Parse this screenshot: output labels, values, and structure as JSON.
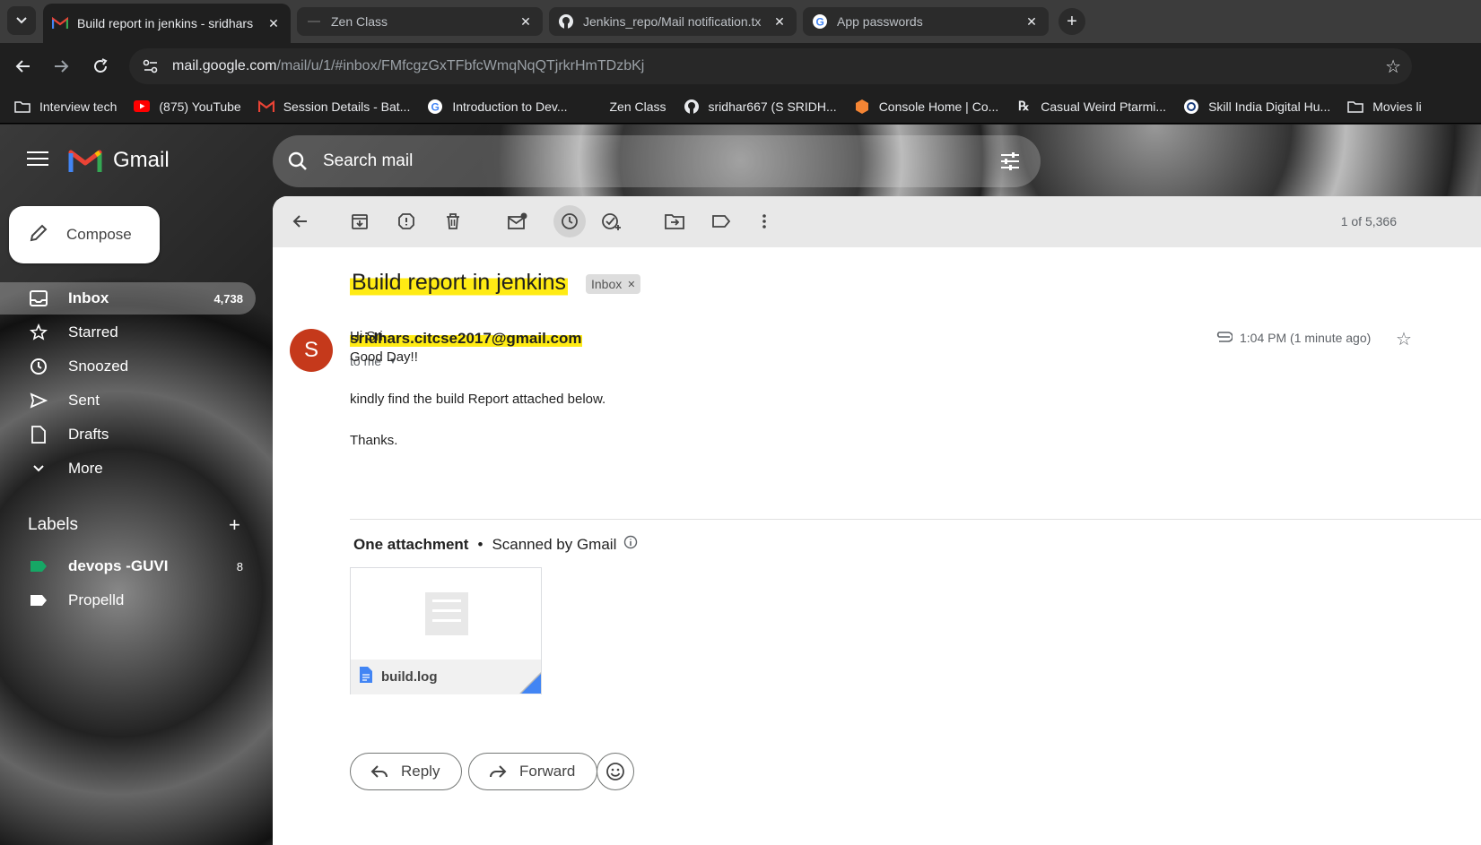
{
  "browser": {
    "tabs": [
      {
        "label": "Build report in jenkins - sridhars",
        "icon": "gmail-icon",
        "active": true
      },
      {
        "label": "Zen Class",
        "icon": "zen-icon",
        "active": false
      },
      {
        "label": "Jenkins_repo/Mail notification.tx",
        "icon": "github-icon",
        "active": false
      },
      {
        "label": "App passwords",
        "icon": "google-icon",
        "active": false
      }
    ],
    "url_host": "mail.google.com",
    "url_path": "/mail/u/1/#inbox/FMfcgzGxTFbfcWmqNqQTjrkrHmTDzbKj",
    "bookmarks": [
      {
        "label": "Interview tech",
        "icon": "folder-icon"
      },
      {
        "label": "(875) YouTube",
        "icon": "youtube-icon"
      },
      {
        "label": "Session Details - Bat...",
        "icon": "gmail-icon"
      },
      {
        "label": "Introduction to Dev...",
        "icon": "google-icon"
      },
      {
        "label": "Zen Class",
        "icon": "zen-icon"
      },
      {
        "label": "sridhar667 (S SRIDH...",
        "icon": "github-icon"
      },
      {
        "label": "Console Home | Co...",
        "icon": "aws-icon"
      },
      {
        "label": "Casual Weird Ptarmi...",
        "icon": "rx-icon"
      },
      {
        "label": "Skill India Digital Hu...",
        "icon": "skill-icon"
      },
      {
        "label": "Movies li",
        "icon": "folder-icon"
      }
    ]
  },
  "gmail": {
    "app_name": "Gmail",
    "search_placeholder": "Search mail",
    "compose_label": "Compose",
    "nav": [
      {
        "label": "Inbox",
        "count": "4,738",
        "icon": "inbox-icon"
      },
      {
        "label": "Starred",
        "count": "",
        "icon": "star-icon"
      },
      {
        "label": "Snoozed",
        "count": "",
        "icon": "clock-icon"
      },
      {
        "label": "Sent",
        "count": "",
        "icon": "send-icon"
      },
      {
        "label": "Drafts",
        "count": "",
        "icon": "draft-icon"
      },
      {
        "label": "More",
        "count": "",
        "icon": "chevron-down-icon"
      }
    ],
    "labels_heading": "Labels",
    "labels": [
      {
        "label": "devops -GUVI",
        "count": "8",
        "color": "#16a765"
      },
      {
        "label": "Propelld",
        "count": "",
        "color": "#ffffff"
      }
    ],
    "pager": "1 of 5,366",
    "email": {
      "subject": "Build report in jenkins",
      "chip": "Inbox",
      "avatar_letter": "S",
      "sender": "sridhars.citcse2017@gmail.com",
      "to": "to me",
      "time": "1:04 PM (1 minute ago)",
      "body": [
        "Hi Sri,",
        "Good Day!!",
        "kindly find the build Report attached below.",
        "Thanks."
      ],
      "attachments_title": "One attachment",
      "scanned": "Scanned by Gmail",
      "attachment_name": "build.log",
      "reply": "Reply",
      "forward": "Forward"
    }
  },
  "colors": {
    "highlight": "#ffeb14",
    "avatar": "#c5391b",
    "accent": "#4285f4"
  }
}
